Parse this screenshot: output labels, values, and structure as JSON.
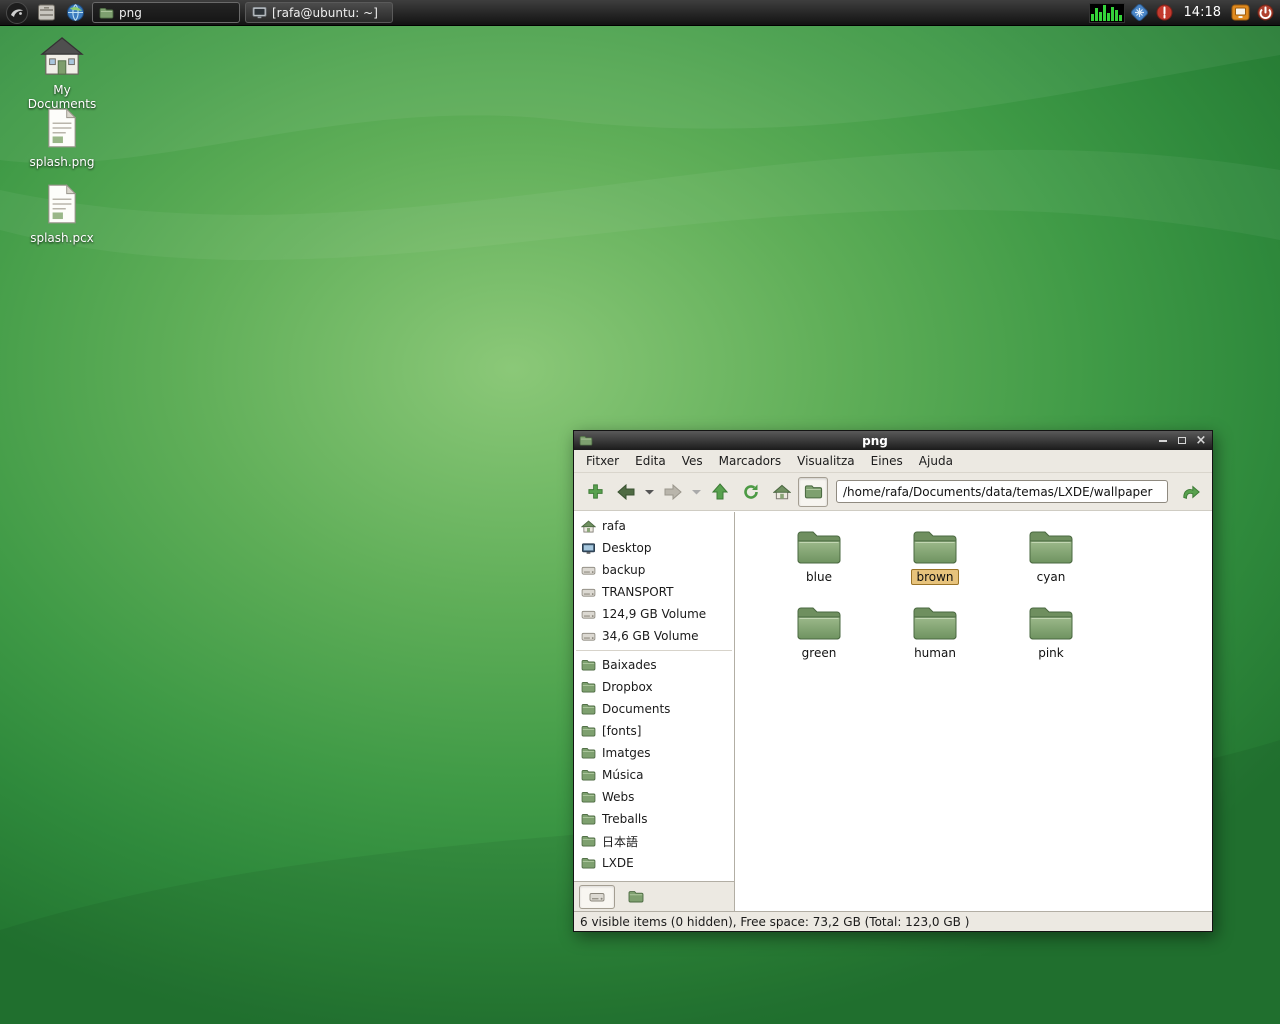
{
  "colors": {
    "wallpaper_green": "#3f9a46",
    "panel_bg": "#1a1a1a",
    "accent_green": "#58a14e",
    "selection_tan": "#e7c37c"
  },
  "panel": {
    "launchers": [
      {
        "icon": "lxde-menu-icon"
      },
      {
        "icon": "file-manager-icon"
      },
      {
        "icon": "web-browser-icon"
      }
    ],
    "tasks": [
      {
        "label": "png",
        "icon": "folder-icon",
        "active": true
      },
      {
        "label": "[rafa@ubuntu: ~]",
        "icon": "terminal-icon",
        "active": false
      }
    ],
    "tray_icons": [
      "cpu-monitor",
      "tray-blue-icon",
      "updates-icon",
      "screen-lock-icon",
      "logout-icon"
    ],
    "clock": "14:18"
  },
  "desktop": {
    "icons": [
      {
        "label": "My Documents",
        "icon": "home-folder-icon"
      },
      {
        "label": "splash.png",
        "icon": "image-file-icon"
      },
      {
        "label": "splash.pcx",
        "icon": "image-file-icon"
      }
    ]
  },
  "window": {
    "title": "png",
    "menu": [
      "Fitxer",
      "Edita",
      "Ves",
      "Marcadors",
      "Visualitza",
      "Eines",
      "Ajuda"
    ],
    "toolbar": {
      "path_value": "/home/rafa/Documents/data/temas/LXDE/wallpaper",
      "buttons": [
        "new-tab",
        "back",
        "back-history",
        "forward",
        "forward-history",
        "up",
        "refresh",
        "home",
        "open-folder",
        "path-entry",
        "go-jump"
      ]
    },
    "sidebar": {
      "places": [
        {
          "label": "rafa",
          "icon": "home-icon"
        },
        {
          "label": "Desktop",
          "icon": "desktop-icon"
        },
        {
          "label": "backup",
          "icon": "drive-icon"
        },
        {
          "label": "TRANSPORT",
          "icon": "drive-icon"
        },
        {
          "label": "124,9 GB Volume",
          "icon": "drive-icon"
        },
        {
          "label": "34,6 GB Volume",
          "icon": "drive-icon"
        }
      ],
      "bookmarks": [
        "Baixades",
        "Dropbox",
        "Documents",
        "[fonts]",
        "Imatges",
        "Música",
        "Webs",
        "Treballs",
        "日本語",
        "LXDE"
      ]
    },
    "files": [
      {
        "name": "blue",
        "selected": false
      },
      {
        "name": "brown",
        "selected": true
      },
      {
        "name": "cyan",
        "selected": false
      },
      {
        "name": "green",
        "selected": false
      },
      {
        "name": "human",
        "selected": false
      },
      {
        "name": "pink",
        "selected": false
      }
    ],
    "statusbar": "6 visible items (0 hidden), Free space: 73,2 GB (Total: 123,0 GB )"
  }
}
